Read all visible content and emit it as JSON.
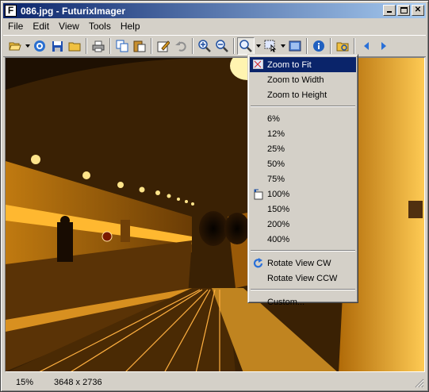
{
  "window": {
    "title": "086.jpg - FuturixImager",
    "app_icon_letter": "F"
  },
  "menu": [
    "File",
    "Edit",
    "View",
    "Tools",
    "Help"
  ],
  "toolbar": {
    "icons": [
      "open-folder-icon",
      "dropdown-arrow",
      "browse-icon",
      "save-icon",
      "folder-icon",
      "print-icon",
      "copy-icon",
      "paste-icon",
      "edit-icon",
      "undo-icon",
      "zoom-in-icon",
      "zoom-out-icon",
      "zoom-menu-icon",
      "select-icon",
      "fullscreen-icon",
      "info-icon",
      "thumbnails-icon",
      "prev-icon",
      "next-icon"
    ]
  },
  "zoom_menu": {
    "fit_items": [
      "Zoom to Fit",
      "Zoom to Width",
      "Zoom to Height"
    ],
    "levels": [
      "6%",
      "12%",
      "25%",
      "50%",
      "75%",
      "100%",
      "150%",
      "200%",
      "400%"
    ],
    "rotate": [
      "Rotate View CW",
      "Rotate View CCW"
    ],
    "custom": "Custom..."
  },
  "status": {
    "zoom": "15%",
    "dimensions": "3648 x 2736"
  },
  "colors": {
    "title_start": "#0a246a",
    "title_end": "#a6caf0",
    "menu_highlight": "#0a246a",
    "face": "#d4d0c8"
  }
}
